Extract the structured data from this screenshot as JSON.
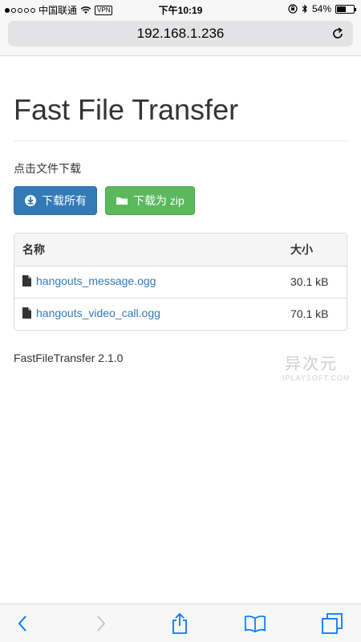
{
  "status_bar": {
    "carrier": "中国联通",
    "vpn": "VPN",
    "time": "下午10:19",
    "battery": "54%",
    "battery_level": 0.54,
    "signal_dots_filled": 1,
    "signal_dots_total": 5
  },
  "address_bar": {
    "url": "192.168.1.236",
    "reload_icon": "reload-icon"
  },
  "page": {
    "title": "Fast File Transfer",
    "subtitle": "点击文件下载",
    "buttons": {
      "download_all": "下载所有",
      "download_zip": "下载为 zip"
    },
    "table": {
      "headers": {
        "name": "名称",
        "size": "大小"
      },
      "rows": [
        {
          "name": "hangouts_message.ogg",
          "size": "30.1 kB"
        },
        {
          "name": "hangouts_video_call.ogg",
          "size": "70.1 kB"
        }
      ]
    },
    "version": "FastFileTransfer 2.1.0"
  },
  "watermark": {
    "main": "异次元",
    "sub": "IPLAYSOFT.COM"
  },
  "toolbar": {
    "icons": [
      "back-icon",
      "forward-icon",
      "share-icon",
      "bookmarks-icon",
      "tabs-icon"
    ]
  },
  "colors": {
    "primary": "#337ab7",
    "success": "#5cb85c",
    "link": "#337ab7",
    "ios_blue": "#007aff"
  }
}
